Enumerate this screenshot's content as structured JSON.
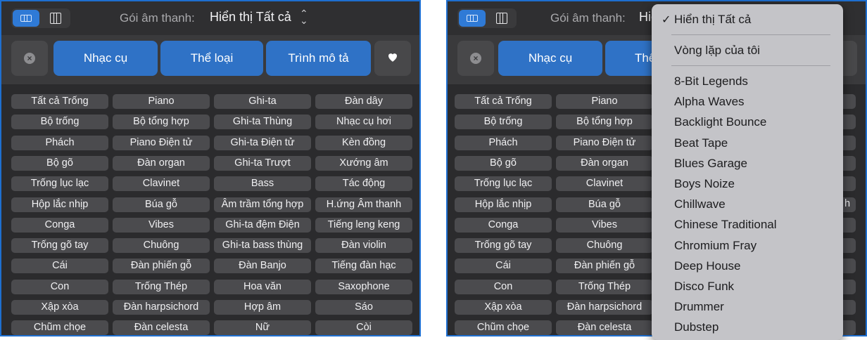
{
  "left_view": {
    "pack_label": "Gói âm thanh:",
    "pack_value": "Hiển thị Tất cả",
    "tabs": [
      "Nhạc cụ",
      "Thể loại",
      "Trình mô tả"
    ],
    "grid": [
      [
        "Tất cả Trống",
        "Piano",
        "Ghi-ta",
        "Đàn dây"
      ],
      [
        "Bộ trống",
        "Bộ tổng hợp",
        "Ghi-ta Thùng",
        "Nhạc cụ hơi"
      ],
      [
        "Phách",
        "Piano Điện tử",
        "Ghi-ta Điện tử",
        "Kèn đồng"
      ],
      [
        "Bộ gõ",
        "Đàn organ",
        "Ghi-ta Trượt",
        "Xướng âm"
      ],
      [
        "Trống lục lạc",
        "Clavinet",
        "Bass",
        "Tác động"
      ],
      [
        "Hộp lắc nhịp",
        "Búa gỗ",
        "Âm trầm tổng hợp",
        "H.ứng Âm thanh"
      ],
      [
        "Conga",
        "Vibes",
        "Ghi-ta đệm Điện",
        "Tiếng leng keng"
      ],
      [
        "Trống gõ tay",
        "Chuông",
        "Ghi-ta bass thùng",
        "Đàn violin"
      ],
      [
        "Cái",
        "Đàn phiến gỗ",
        "Đàn Banjo",
        "Tiếng đàn hạc"
      ],
      [
        "Con",
        "Trống Thép",
        "Hoa văn",
        "Saxophone"
      ],
      [
        "Xập xòa",
        "Đàn harpsichord",
        "Hợp âm",
        "Sáo"
      ],
      [
        "Chũm chọe",
        "Đàn celesta",
        "Nữ",
        "Còi"
      ]
    ]
  },
  "right_view": {
    "pack_label": "Gói âm thanh:",
    "pack_value_partial": "Hiể",
    "tabs_visible": [
      "Nhạc cụ",
      "Thể"
    ],
    "grid_col1": [
      "Tất cả Trống",
      "Bộ trống",
      "Phách",
      "Bộ gõ",
      "Trống lục lạc",
      "Hộp lắc nhịp",
      "Conga",
      "Trống gõ tay",
      "Cái",
      "Con",
      "Xập xòa",
      "Chũm chọe"
    ],
    "grid_col2": [
      "Piano",
      "Bộ tổng hợp",
      "Piano Điện tử",
      "Đàn organ",
      "Clavinet",
      "Búa gỗ",
      "Vibes",
      "Chuông",
      "Đàn phiến gỗ",
      "Trống Thép",
      "Đàn harpsichord",
      "Đàn celesta"
    ],
    "row6_col4_partial": "h",
    "menu": {
      "checkmark": "✓",
      "selected": "Hiển thị Tất cả",
      "my_loops": "Vòng lặp của tôi",
      "packs": [
        "8-Bit Legends",
        "Alpha Waves",
        "Backlight Bounce",
        "Beat Tape",
        "Blues Garage",
        "Boys Noize",
        "Chillwave",
        "Chinese Traditional",
        "Chromium Fray",
        "Deep House",
        "Disco Funk",
        "Drummer",
        "Dubstep"
      ]
    }
  },
  "colors": {
    "panel_bg": "#2b2b2d",
    "accent": "#2f72c6",
    "frame": "#1e6fd0",
    "cell_bg": "#4b4b4e",
    "menu_bg": "#c4c4c8"
  }
}
